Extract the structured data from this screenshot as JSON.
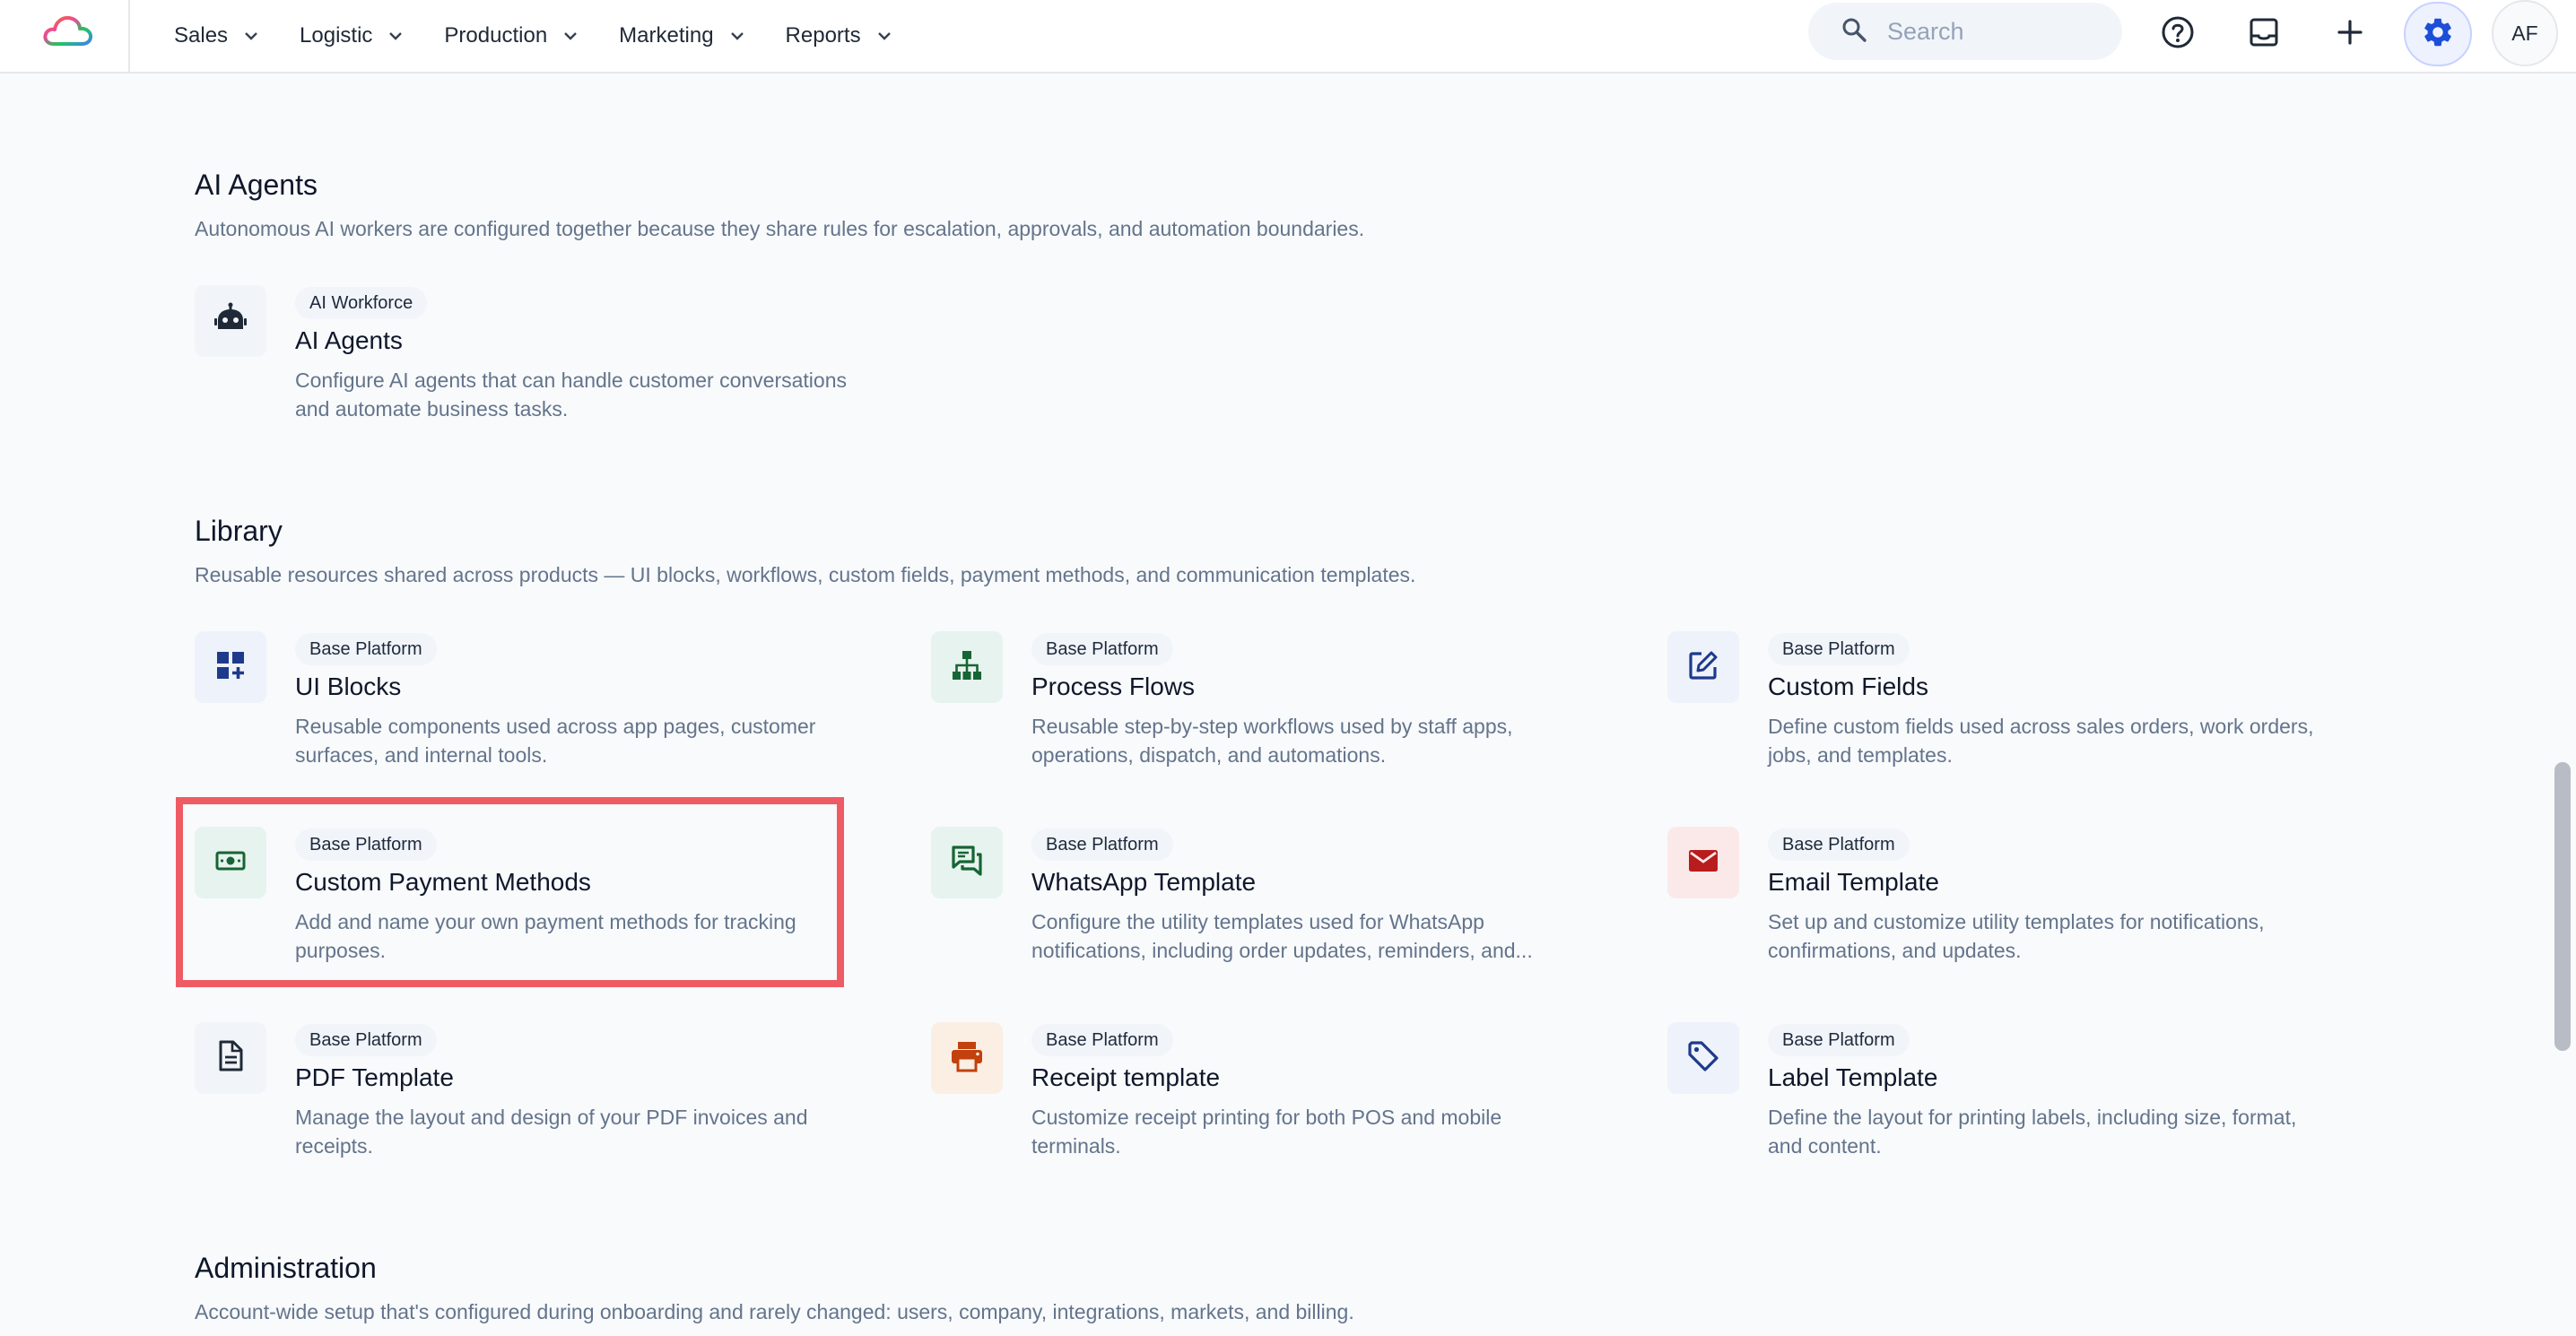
{
  "header": {
    "nav": [
      {
        "label": "Sales"
      },
      {
        "label": "Logistic"
      },
      {
        "label": "Production"
      },
      {
        "label": "Marketing"
      },
      {
        "label": "Reports"
      }
    ],
    "search_placeholder": "Search",
    "avatar_initials": "AF"
  },
  "sections": {
    "ai_agents": {
      "title": "AI Agents",
      "description": "Autonomous AI workers are configured together because they share rules for escalation, approvals, and automation boundaries.",
      "cards": [
        {
          "badge": "AI Workforce",
          "title": "AI Agents",
          "description": "Configure AI agents that can handle customer conversations and automate business tasks.",
          "icon": "robot-icon"
        }
      ]
    },
    "library": {
      "title": "Library",
      "description": "Reusable resources shared across products — UI blocks, workflows, custom fields, payment methods, and communication templates.",
      "cards": [
        {
          "badge": "Base Platform",
          "title": "UI Blocks",
          "description": "Reusable components used across app pages, customer surfaces, and internal tools.",
          "icon": "dashboard-add-icon"
        },
        {
          "badge": "Base Platform",
          "title": "Process Flows",
          "description": "Reusable step-by-step workflows used by staff apps, operations, dispatch, and automations.",
          "icon": "sitemap-icon"
        },
        {
          "badge": "Base Platform",
          "title": "Custom Fields",
          "description": "Define custom fields used across sales orders, work orders, jobs, and templates.",
          "icon": "edit-square-icon"
        },
        {
          "badge": "Base Platform",
          "title": "Custom Payment Methods",
          "description": "Add and name your own payment methods for tracking purposes.",
          "icon": "banknote-icon"
        },
        {
          "badge": "Base Platform",
          "title": "WhatsApp Template",
          "description": "Configure the utility templates used for WhatsApp notifications, including order updates, reminders, and...",
          "icon": "chat-icon"
        },
        {
          "badge": "Base Platform",
          "title": "Email Template",
          "description": "Set up and customize utility templates for notifications, confirmations, and updates.",
          "icon": "mail-icon"
        },
        {
          "badge": "Base Platform",
          "title": "PDF Template",
          "description": "Manage the layout and design of your PDF invoices and receipts.",
          "icon": "document-icon"
        },
        {
          "badge": "Base Platform",
          "title": "Receipt template",
          "description": "Customize receipt printing for both POS and mobile terminals.",
          "icon": "printer-icon"
        },
        {
          "badge": "Base Platform",
          "title": "Label Template",
          "description": "Define the layout for printing labels, including size, format, and content.",
          "icon": "tag-icon"
        }
      ]
    },
    "administration": {
      "title": "Administration",
      "description": "Account-wide setup that's configured during onboarding and rarely changed: users, company, integrations, markets, and billing."
    }
  },
  "colors": {
    "accent": "#2563eb",
    "highlight": "#ef5b64",
    "text_muted": "#64748b"
  }
}
